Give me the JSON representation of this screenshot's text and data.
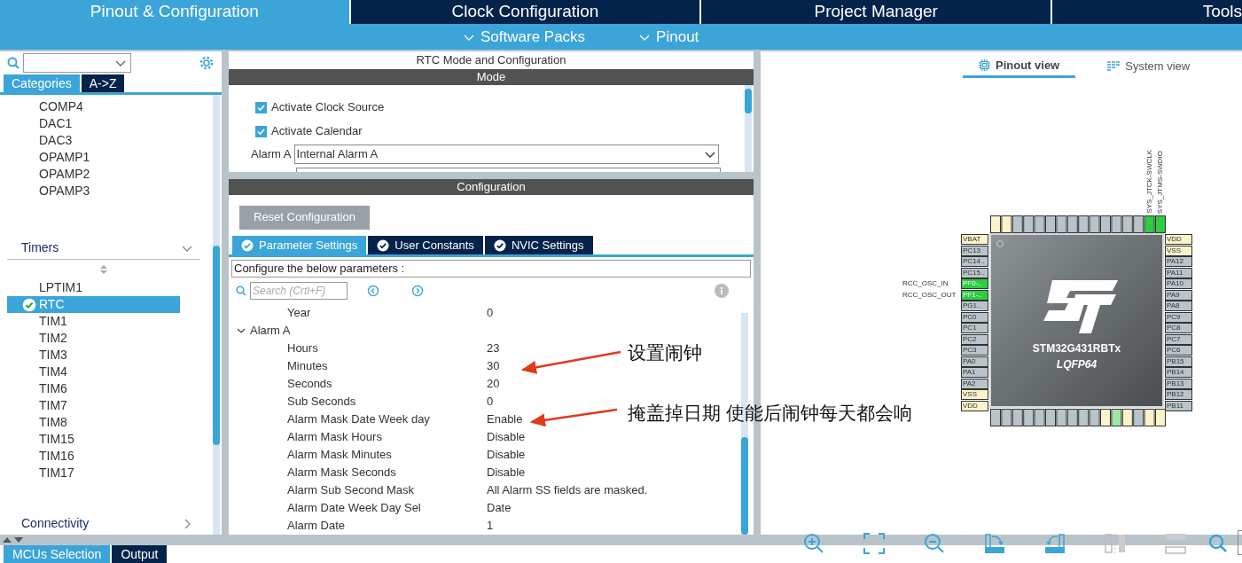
{
  "top_tabs": [
    {
      "label": "Pinout & Configuration",
      "selected": true
    },
    {
      "label": "Clock Configuration",
      "selected": false
    },
    {
      "label": "Project Manager",
      "selected": false
    },
    {
      "label": "Tools",
      "selected": false
    }
  ],
  "sub_menu": [
    "Software Packs",
    "Pinout"
  ],
  "sidebar": {
    "filter_tabs": [
      {
        "label": "Categories",
        "selected": true
      },
      {
        "label": "A->Z",
        "selected": false
      }
    ],
    "items": [
      {
        "kind": "item",
        "label": "COMP4",
        "selected": false
      },
      {
        "kind": "item",
        "label": "DAC1",
        "selected": false
      },
      {
        "kind": "item",
        "label": "DAC3",
        "selected": false
      },
      {
        "kind": "item",
        "label": "OPAMP1",
        "selected": false
      },
      {
        "kind": "item",
        "label": "OPAMP2",
        "selected": false
      },
      {
        "kind": "item",
        "label": "OPAMP3",
        "selected": false
      },
      {
        "kind": "category",
        "label": "Timers",
        "expanded": true,
        "children": [
          {
            "label": "LPTIM1",
            "selected": false,
            "configured": false
          },
          {
            "label": "RTC",
            "selected": true,
            "configured": true
          },
          {
            "label": "TIM1",
            "selected": false,
            "configured": false
          },
          {
            "label": "TIM2",
            "selected": false,
            "configured": false
          },
          {
            "label": "TIM3",
            "selected": false,
            "configured": false
          },
          {
            "label": "TIM4",
            "selected": false,
            "configured": false
          },
          {
            "label": "TIM6",
            "selected": false,
            "configured": false
          },
          {
            "label": "TIM7",
            "selected": false,
            "configured": false
          },
          {
            "label": "TIM8",
            "selected": false,
            "configured": false
          },
          {
            "label": "TIM15",
            "selected": false,
            "configured": false
          },
          {
            "label": "TIM16",
            "selected": false,
            "configured": false
          },
          {
            "label": "TIM17",
            "selected": false,
            "configured": false
          }
        ]
      },
      {
        "kind": "category",
        "label": "Connectivity",
        "expanded": false
      }
    ]
  },
  "mode_panel": {
    "title": "RTC Mode and Configuration",
    "header": "Mode",
    "checkboxes": [
      {
        "label": "Activate Clock Source",
        "checked": true
      },
      {
        "label": "Activate Calendar",
        "checked": true
      }
    ],
    "alarm_a": {
      "label": "Alarm A",
      "value": "Internal Alarm A"
    }
  },
  "config_panel": {
    "header": "Configuration",
    "reset_button": "Reset Configuration",
    "tabs": [
      {
        "label": "Parameter Settings",
        "selected": true
      },
      {
        "label": "User Constants",
        "selected": false
      },
      {
        "label": "NVIC Settings",
        "selected": false
      }
    ],
    "hint": "Configure the below parameters :",
    "search": {
      "placeholder": "Search (Crtl+F)"
    },
    "parameters": [
      {
        "label": "Year",
        "value": "0"
      },
      {
        "label": "Alarm A",
        "expanded": true,
        "children": [
          {
            "label": "Hours",
            "value": "23"
          },
          {
            "label": "Minutes",
            "value": "30"
          },
          {
            "label": "Seconds",
            "value": "20"
          },
          {
            "label": "Sub Seconds",
            "value": "0"
          },
          {
            "label": "Alarm Mask Date Week day",
            "value": "Enable"
          },
          {
            "label": "Alarm Mask Hours",
            "value": "Disable"
          },
          {
            "label": "Alarm Mask Minutes",
            "value": "Disable"
          },
          {
            "label": "Alarm Mask Seconds",
            "value": "Disable"
          },
          {
            "label": "Alarm Sub Second Mask",
            "value": "All Alarm SS fields are masked."
          },
          {
            "label": "Alarm Date Week Day Sel",
            "value": "Date"
          },
          {
            "label": "Alarm Date",
            "value": "1"
          }
        ]
      }
    ]
  },
  "annotations": [
    {
      "text": "设置闹钟"
    },
    {
      "text": "掩盖掉日期 使能后闹钟每天都会响"
    }
  ],
  "view_tabs": [
    {
      "label": "Pinout view",
      "selected": true
    },
    {
      "label": "System view",
      "selected": false
    }
  ],
  "chip": {
    "name": "STM32G431RBTx",
    "package": "LQFP64",
    "left_pins": [
      {
        "label": "VBAT",
        "kind": "power"
      },
      {
        "label": "PC13",
        "kind": "io"
      },
      {
        "label": "PC14..",
        "kind": "io"
      },
      {
        "label": "PC15..",
        "kind": "io"
      },
      {
        "label": "PF0-..",
        "kind": "used",
        "signal": "RCC_OSC_IN"
      },
      {
        "label": "PF1-..",
        "kind": "used",
        "signal": "RCC_OSC_OUT"
      },
      {
        "label": "PG1..",
        "kind": "io"
      },
      {
        "label": "PC0",
        "kind": "io"
      },
      {
        "label": "PC1",
        "kind": "io"
      },
      {
        "label": "PC2",
        "kind": "io"
      },
      {
        "label": "PC3",
        "kind": "io"
      },
      {
        "label": "PA0",
        "kind": "io"
      },
      {
        "label": "PA1",
        "kind": "io"
      },
      {
        "label": "PA2",
        "kind": "io"
      },
      {
        "label": "VSS",
        "kind": "power"
      },
      {
        "label": "VDD",
        "kind": "power"
      }
    ],
    "right_pins": [
      {
        "label": "VDD",
        "kind": "power"
      },
      {
        "label": "VSS",
        "kind": "power"
      },
      {
        "label": "PA12",
        "kind": "io"
      },
      {
        "label": "PA11",
        "kind": "io"
      },
      {
        "label": "PA10",
        "kind": "io"
      },
      {
        "label": "PA9",
        "kind": "io"
      },
      {
        "label": "PA8",
        "kind": "io"
      },
      {
        "label": "PC9",
        "kind": "io"
      },
      {
        "label": "PC8",
        "kind": "io"
      },
      {
        "label": "PC7",
        "kind": "io"
      },
      {
        "label": "PC6",
        "kind": "io"
      },
      {
        "label": "PB15",
        "kind": "io"
      },
      {
        "label": "PB14",
        "kind": "io"
      },
      {
        "label": "PB13",
        "kind": "io"
      },
      {
        "label": "PB12",
        "kind": "io"
      },
      {
        "label": "PB11",
        "kind": "io"
      }
    ],
    "top_signals": [
      "SYS_JTCK-SWCLK",
      "SYS_JTMS-SWDIO"
    ]
  },
  "bottom_tabs": [
    {
      "label": "MCUs Selection",
      "selected": true
    },
    {
      "label": "Output",
      "selected": false
    }
  ]
}
